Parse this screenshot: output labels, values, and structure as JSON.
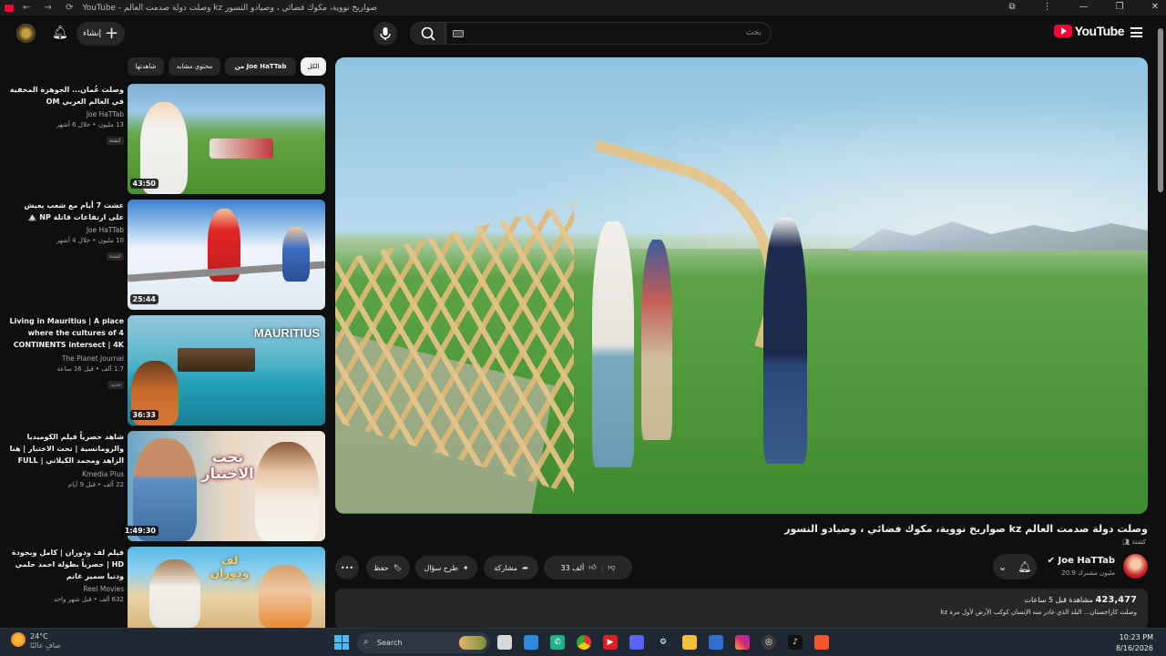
{
  "browser": {
    "tab_title": "YouTube - وصلت دولة صدمت العالم kz صواريخ نووية، مكوك فضائي ، وصيادو النسور",
    "nav_glyphs": "← →  ⟳",
    "window_controls": [
      "⧉",
      "⋮",
      "—",
      "❐",
      "✕"
    ]
  },
  "header": {
    "logo_text": "YouTube",
    "search_placeholder": "بحث",
    "create_label": "إنشاء",
    "icons": {
      "search": "search-icon",
      "mic": "mic-icon",
      "bell": "bell-icon",
      "menu": "menu-icon"
    }
  },
  "video": {
    "title": "وصلت دولة صدمت العالم kz صواريخ نووية، مكوك فضائي ، وصيادو النسور",
    "tag": "كشتة",
    "channel_name": "Joe HaTTab",
    "subscribers": "20.9 مليون مشترك",
    "likes": "33 ألف",
    "share_label": "مشاركة",
    "ask_label": "طرح سؤال",
    "save_label": "حفظ",
    "more_label": "•••",
    "views": "423,477",
    "views_suffix": "مشاهدة قبل 5 ساعات",
    "description": "وصلت كازاخستان... البلد الذي غادر منه الإنسان كوكب الأرض لأول مرة kz"
  },
  "chips": [
    "الكل",
    "من Joe HaTTab",
    "محتوى مشابه",
    "شاهدتها"
  ],
  "recommendations": [
    {
      "title": "وصلت عُمان... الجوهرة المخفية في العالم العربي OM",
      "channel": "Joe HaTTab",
      "meta": "13 مليون ‣ خلال 6 أشهر",
      "badge": "كشتة",
      "duration": "43:50",
      "rtl": true
    },
    {
      "title": "عشت 7 أيام مع شعب يعيش على ارتفاعات قاتلة NP 🏔️",
      "channel": "Joe HaTTab",
      "meta": "10 مليون ‣ خلال 4 أشهر",
      "badge": "كشتة",
      "duration": "25:44",
      "rtl": true
    },
    {
      "title": "Living in Mauritius | A place where the cultures of 4 CONTINENTS intersect | 4K ...",
      "channel": "The Planet Journal",
      "meta": "1.7 ألف ‣ قبل 16 ساعة",
      "badge": "جديد",
      "duration": "36:33",
      "rtl": false
    },
    {
      "title": "شاهد حصرياً فيلم الكوميديا والرومانسية | تحت الاختبار | هنا الزاهد ومحمد الكيلاني | FULL HD 🎬",
      "channel": "Kmedia Plus",
      "meta": "22 ألف ‣ قبل 9 أيام",
      "badge": "",
      "duration": "1:49:30",
      "rtl": true
    },
    {
      "title": "فيلم لف ودوران | كامل وبجودة HD | حصرياً بطولة احمد حلمي ودنيا سمير غانم",
      "channel": "Reel Movies",
      "meta": "632 ألف ‣ قبل شهر واحد",
      "badge": "",
      "duration": "",
      "rtl": true
    }
  ],
  "thumb_text": {
    "mauritius": "MAURITIUS",
    "tahta": "تحت الاختبار",
    "laf": "لف ودوران"
  },
  "taskbar": {
    "temperature": "24°C",
    "weather": "صافٍ غالبًا",
    "search_label": "Search",
    "time": "10:23 PM",
    "date": "8/16/2026"
  }
}
